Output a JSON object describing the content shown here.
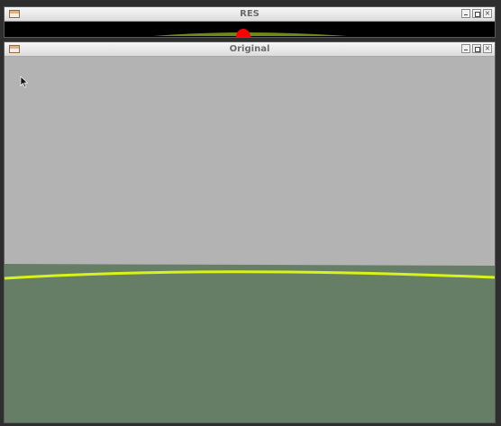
{
  "windows": {
    "res": {
      "title": "RES",
      "buttons": {
        "minimize": "minimize",
        "maximize": "maximize",
        "close": "×"
      }
    },
    "original": {
      "title": "Original",
      "buttons": {
        "minimize": "minimize",
        "maximize": "maximize",
        "close": "×"
      }
    }
  },
  "colors": {
    "sky": "#b3b3b3",
    "ground": "#667e66",
    "horizon_line": "#d8f21a",
    "res_background": "#000000",
    "res_marker": "#ff0000",
    "res_line": "#6f8a16"
  },
  "icons": {
    "app": "app-window-icon",
    "cursor": "mouse-pointer-icon"
  }
}
